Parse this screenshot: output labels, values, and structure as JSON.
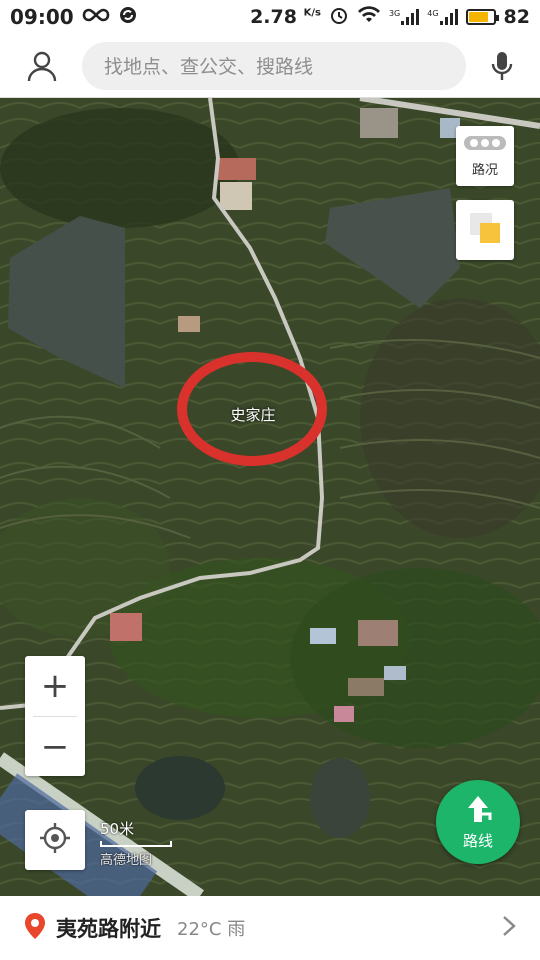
{
  "status_bar": {
    "time": "09:00",
    "speed": "2.78",
    "speed_unit": "K/s",
    "net1": "3G",
    "net2": "4G",
    "battery": "82",
    "battery_level": 0.82
  },
  "search": {
    "placeholder": "找地点、查公交、搜路线"
  },
  "map": {
    "place_label": "史家庄",
    "traffic_label": "路况",
    "scale_label": "50米",
    "brand_label": "高德地图",
    "route_label": "路线",
    "zoom_in": "+",
    "zoom_out": "−",
    "highlight_color": "#d9312b",
    "route_color": "#1db56a"
  },
  "bottom": {
    "location": "夷苑路附近",
    "weather": "22°C 雨"
  }
}
